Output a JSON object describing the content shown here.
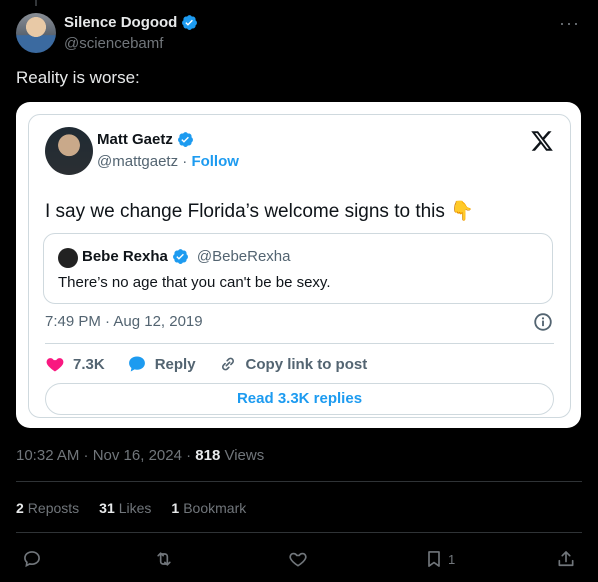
{
  "post": {
    "author_name": "Silence Dogood",
    "author_handle": "@sciencebamf",
    "more_label": "···",
    "text": "Reality is worse:",
    "timestamp": "10:32 AM · Nov 16, 2024 · ",
    "views_count": "818",
    "views_label": " Views"
  },
  "embed": {
    "author_name": "Matt Gaetz",
    "author_handle": "@mattgaetz",
    "separator": " · ",
    "follow_label": "Follow",
    "text": "I say we change Florida’s welcome signs to this",
    "emoji": "👇",
    "quote": {
      "author_name": "Bebe Rexha",
      "author_handle": "@BebeRexha",
      "text": "There’s no age that you can't be be sexy."
    },
    "time": "7:49 PM · Aug 12, 2019",
    "likes": "7.3K",
    "reply_label": "Reply",
    "copy_label": "Copy link to post",
    "read_replies_label": "Read 3.3K replies"
  },
  "stats": {
    "reposts_count": "2",
    "reposts_label": "Reposts",
    "likes_count": "31",
    "likes_label": "Likes",
    "bookmarks_count": "1",
    "bookmarks_label": "Bookmark"
  },
  "actions": {
    "bookmark_count": "1"
  },
  "colors": {
    "verified": "#1d9bf0",
    "like": "#f91880",
    "link": "#1d9bf0",
    "background": "#000000"
  }
}
